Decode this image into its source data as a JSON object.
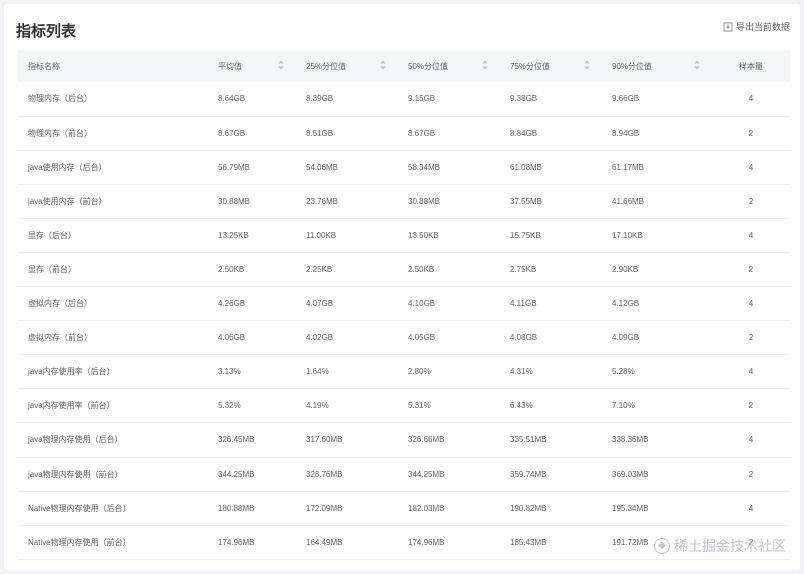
{
  "panel": {
    "title": "指标列表",
    "export_label": "导出当前数据"
  },
  "table": {
    "columns": [
      "指标名称",
      "平均值",
      "25%分位值",
      "50%分位值",
      "75%分位值",
      "90%分位值",
      "样本量"
    ],
    "rows": [
      [
        "物理内存（后台）",
        "8.64GB",
        "8.39GB",
        "9.15GB",
        "9.38GB",
        "9.66GB",
        "4"
      ],
      [
        "物理内存（前台）",
        "8.67GB",
        "8.51GB",
        "8.67GB",
        "8.84GB",
        "8.94GB",
        "2"
      ],
      [
        "java使用内存（后台）",
        "56.79MB",
        "54.06MB",
        "58.34MB",
        "61.08MB",
        "61.17MB",
        "4"
      ],
      [
        "java使用内存（前台）",
        "30.88MB",
        "23.76MB",
        "30.88MB",
        "37.55MB",
        "41.66MB",
        "2"
      ],
      [
        "显存（后台）",
        "13.25KB",
        "11.00KB",
        "13.50KB",
        "15.75KB",
        "17.10KB",
        "4"
      ],
      [
        "显存（前台）",
        "2.50KB",
        "2.25KB",
        "2.50KB",
        "2.75KB",
        "2.90KB",
        "2"
      ],
      [
        "虚拟内存（后台）",
        "4.26GB",
        "4.07GB",
        "4.10GB",
        "4.11GB",
        "4.12GB",
        "4"
      ],
      [
        "虚拟内存（前台）",
        "4.06GB",
        "4.02GB",
        "4.05GB",
        "4.08GB",
        "4.09GB",
        "2"
      ],
      [
        "java内存使用率（后台）",
        "3.13%",
        "1.64%",
        "2.80%",
        "4.31%",
        "5.28%",
        "4"
      ],
      [
        "java内存使用率（前台）",
        "5.32%",
        "4.19%",
        "5.31%",
        "6.43%",
        "7.10%",
        "2"
      ],
      [
        "java物理内存使用（后台）",
        "326.45MB",
        "317.60MB",
        "326.66MB",
        "335.51MB",
        "338.36MB",
        "4"
      ],
      [
        "java物理内存使用（前台）",
        "344.25MB",
        "328.76MB",
        "344.25MB",
        "359.74MB",
        "369.03MB",
        "2"
      ],
      [
        "Native物理内存使用（后台）",
        "180.88MB",
        "172.09MB",
        "182.03MB",
        "190.82MB",
        "195.34MB",
        "4"
      ],
      [
        "Native物理内存使用（前台）",
        "174.96MB",
        "164.49MB",
        "174.96MB",
        "185.43MB",
        "191.72MB",
        "2"
      ]
    ]
  },
  "watermark": {
    "text": "稀土掘金技术社区",
    "logo_icon": "juejin-logo-icon"
  },
  "colors": {
    "page_bg": "#f0f2f5",
    "header_row_bg": "#f5f6f8",
    "text": "#606266"
  }
}
